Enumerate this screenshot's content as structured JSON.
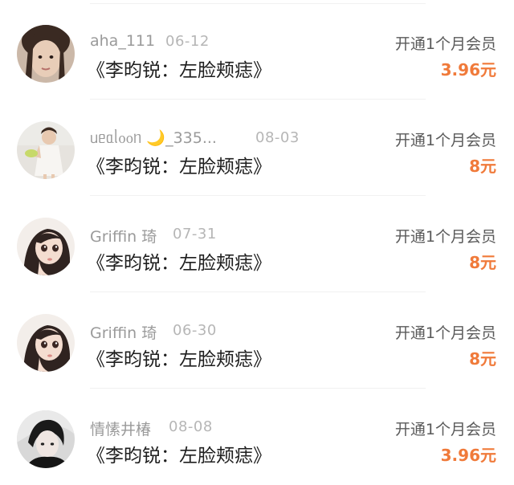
{
  "rows": [
    {
      "avatar_icon": "user-avatar-photo-girl",
      "username": "aha_111",
      "date": "06-12",
      "title": "《李昀锐：左脸颊痣》",
      "action": "开通1个月会员",
      "price": "3.96元"
    },
    {
      "avatar_icon": "user-avatar-photo-child",
      "username": "ᥙᥱᥲᥣ᧐᧐ᥒ 🌙_335...",
      "date": "08-03",
      "title": "《李昀锐：左脸颊痣》",
      "action": "开通1个月会员",
      "price": "8元"
    },
    {
      "avatar_icon": "user-avatar-illustration-girl",
      "username": "Griffin 琦",
      "date": "07-31",
      "title": "《李昀锐：左脸颊痣》",
      "action": "开通1个月会员",
      "price": "8元"
    },
    {
      "avatar_icon": "user-avatar-illustration-girl",
      "username": "Griffin 琦",
      "date": "06-30",
      "title": "《李昀锐：左脸颊痣》",
      "action": "开通1个月会员",
      "price": "8元"
    },
    {
      "avatar_icon": "user-avatar-photo-boy",
      "username": "情愫井椿",
      "date": "08-08",
      "title": "《李昀锐：左脸颊痣》",
      "action": "开通1个月会员",
      "price": "3.96元"
    }
  ]
}
